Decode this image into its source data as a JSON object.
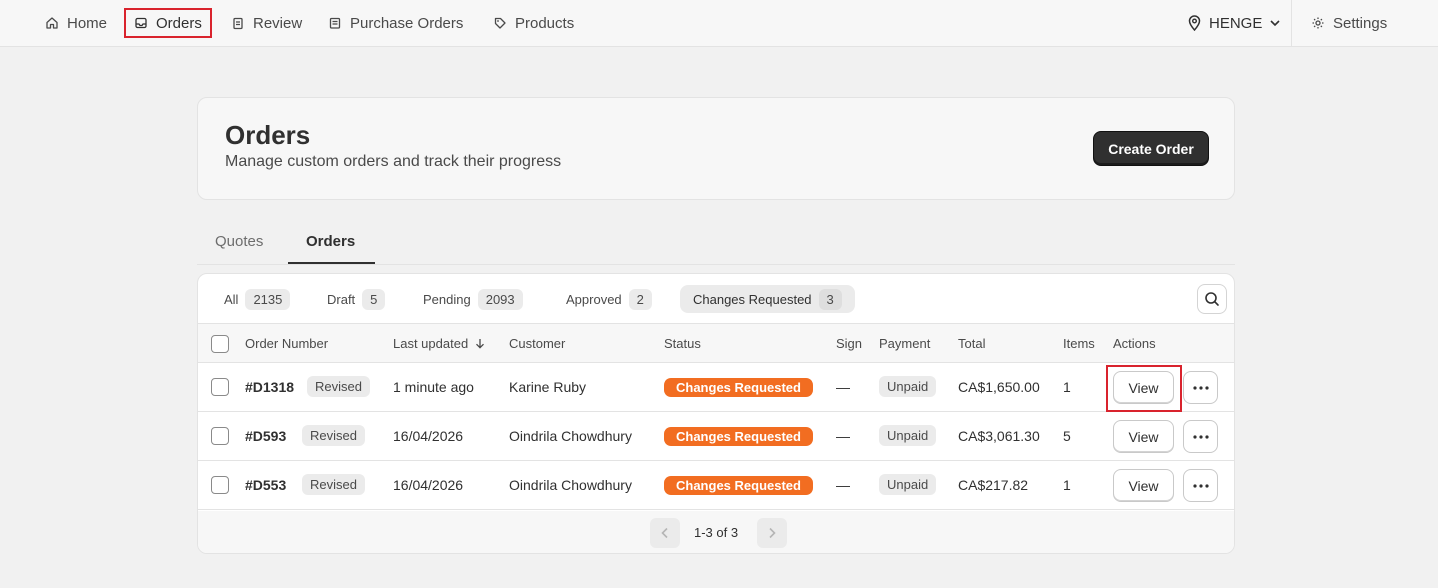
{
  "nav": {
    "items": [
      {
        "label": "Home",
        "icon": "home-icon"
      },
      {
        "label": "Orders",
        "icon": "inbox-icon"
      },
      {
        "label": "Review",
        "icon": "clipboard-icon"
      },
      {
        "label": "Purchase Orders",
        "icon": "receipt-icon"
      },
      {
        "label": "Products",
        "icon": "tag-icon"
      }
    ],
    "location": {
      "label": "HENGE",
      "icon": "location-pin-icon"
    },
    "settings": {
      "label": "Settings",
      "icon": "gear-icon"
    }
  },
  "header": {
    "title": "Orders",
    "subtitle": "Manage custom orders and track their progress",
    "create_label": "Create Order"
  },
  "tabs": [
    {
      "label": "Quotes",
      "active": false
    },
    {
      "label": "Orders",
      "active": true
    }
  ],
  "filters": [
    {
      "label": "All",
      "count": "2135"
    },
    {
      "label": "Draft",
      "count": "5"
    },
    {
      "label": "Pending",
      "count": "2093"
    },
    {
      "label": "Approved",
      "count": "2"
    },
    {
      "label": "Changes Requested",
      "count": "3",
      "active": true
    }
  ],
  "table": {
    "columns": [
      "Order Number",
      "Last updated",
      "Customer",
      "Status",
      "Sign",
      "Payment",
      "Total",
      "Items",
      "Actions"
    ],
    "rows": [
      {
        "order": "#D1318",
        "tag": "Revised",
        "updated": "1 minute ago",
        "customer": "Karine Ruby",
        "status": "Changes Requested",
        "sign": "—",
        "payment": "Unpaid",
        "total": "CA$1,650.00",
        "items": "1",
        "view": "View"
      },
      {
        "order": "#D593",
        "tag": "Revised",
        "updated": "16/04/2026",
        "customer": "Oindrila Chowdhury",
        "status": "Changes Requested",
        "sign": "—",
        "payment": "Unpaid",
        "total": "CA$3,061.30",
        "items": "5",
        "view": "View"
      },
      {
        "order": "#D553",
        "tag": "Revised",
        "updated": "16/04/2026",
        "customer": "Oindrila Chowdhury",
        "status": "Changes Requested",
        "sign": "—",
        "payment": "Unpaid",
        "total": "CA$217.82",
        "items": "1",
        "view": "View"
      }
    ]
  },
  "pagination": {
    "label": "1-3 of 3"
  },
  "colors": {
    "accent_status": "#f26d21",
    "highlight": "#d9232d",
    "primary_button": "#303030"
  }
}
